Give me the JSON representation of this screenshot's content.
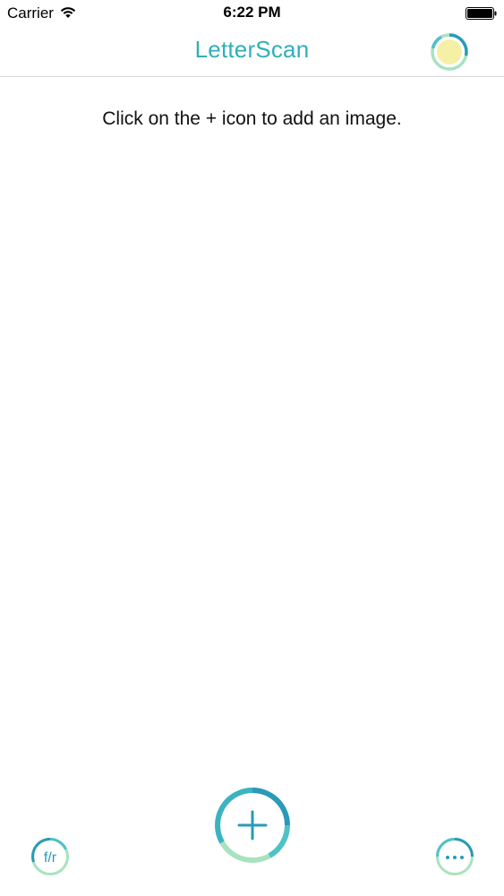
{
  "status_bar": {
    "carrier": "Carrier",
    "time": "6:22 PM",
    "wifi_icon": "wifi-icon",
    "battery_icon": "battery-full-icon"
  },
  "nav": {
    "title": "LetterScan",
    "right_icon": "sun-icon"
  },
  "main": {
    "hint": "Click on the + icon to add an image."
  },
  "toolbar": {
    "left_label": "f/r",
    "center_icon": "plus-icon",
    "right_icon": "more-icon"
  },
  "colors": {
    "accent": "#2fb0b6",
    "ring_dark": "#2a9ab8",
    "ring_light": "#a8e2bf",
    "sun_fill": "#f6efa6"
  }
}
